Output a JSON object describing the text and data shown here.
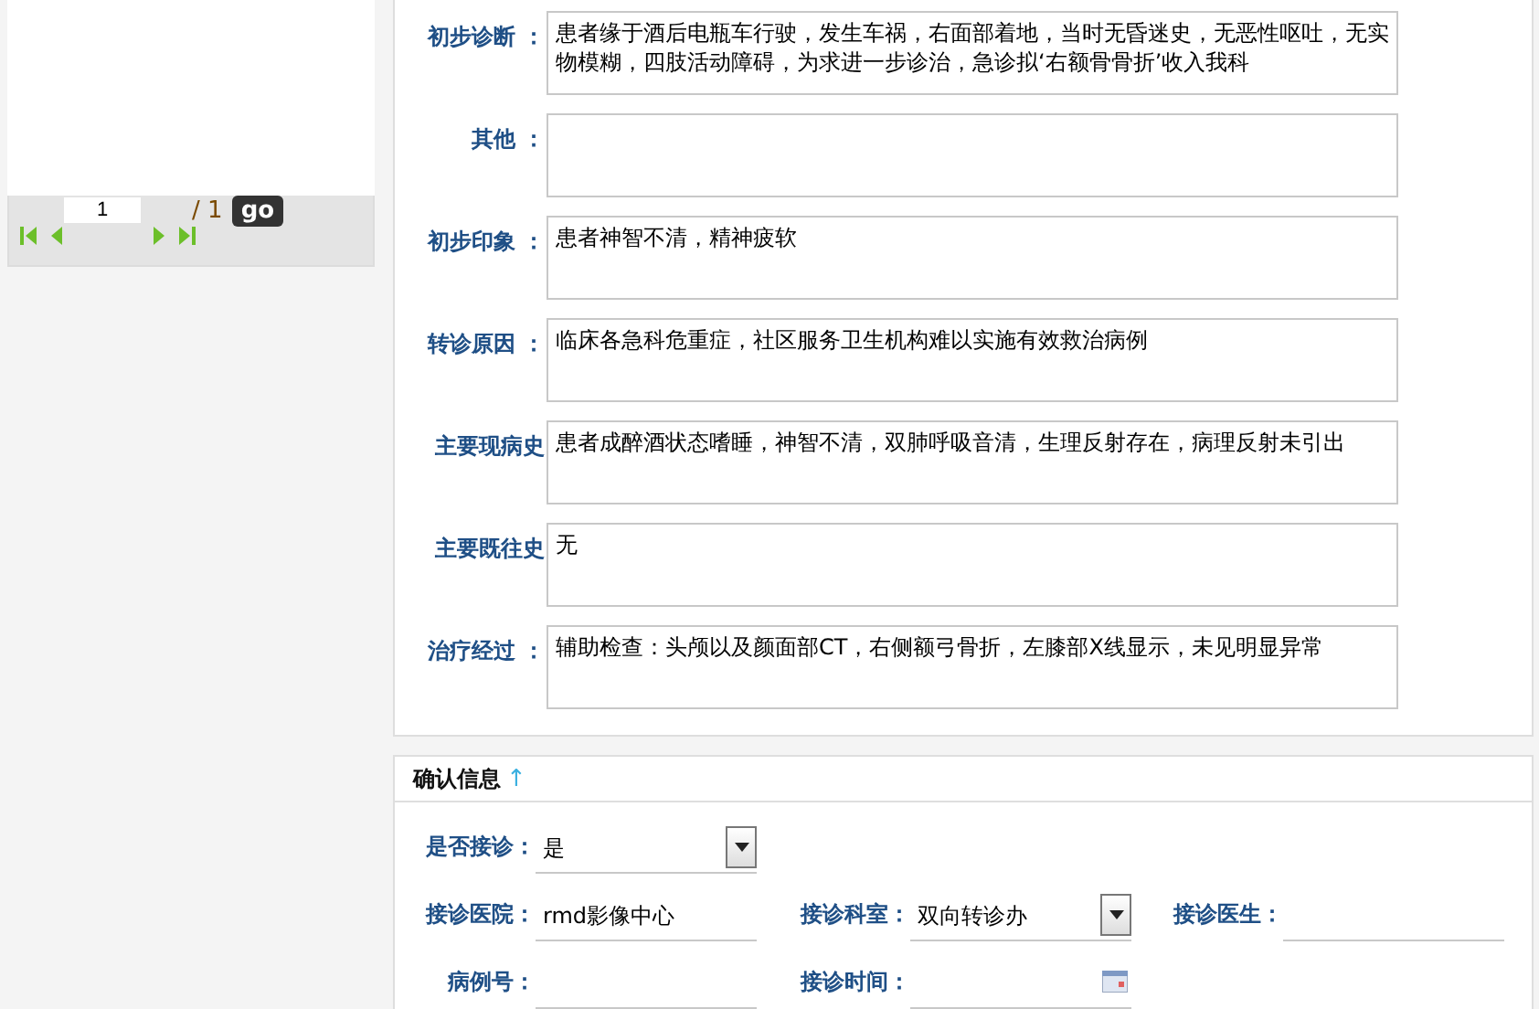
{
  "pager": {
    "page": "1",
    "total": "/ 1",
    "go": "go"
  },
  "record_fields": [
    {
      "label": "初步诊断 ：",
      "value": "患者缘于酒后电瓶车行驶，发生车祸，右面部着地，当时无昏迷史，无恶性呕吐，无实物模糊，四肢活动障碍，为求进一步诊治，急诊拟‘右额骨骨折’收入我科"
    },
    {
      "label": "其他 ："
    },
    {
      "label": "初步印象 ：",
      "value": "患者神智不清，精神疲软"
    },
    {
      "label": "转诊原因 ：",
      "value": "临床各急科危重症，社区服务卫生机构难以实施有效救治病例"
    },
    {
      "label": "主要现病史",
      "value": "患者成醉酒状态嗜睡，神智不清，双肺呼吸音清，生理反射存在，病理反射未引出"
    },
    {
      "label": "主要既往史",
      "value": "无"
    },
    {
      "label": "治疗经过 ：",
      "value": "辅助检查：头颅以及颜面部CT，右侧额弓骨折，左膝部X线显示，未见明显异常"
    }
  ],
  "confirm": {
    "title": "确认信息",
    "arrow": "↑",
    "rows": [
      [
        {
          "label": "是否接诊：",
          "kind": "select",
          "value": "是"
        }
      ],
      [
        {
          "label": "接诊医院：",
          "kind": "text",
          "value": "rmd影像中心"
        },
        {
          "label": "接诊科室：",
          "kind": "select",
          "value": "双向转诊办"
        },
        {
          "label": "接诊医生：",
          "kind": "text"
        }
      ],
      [
        {
          "label": "病例号：",
          "kind": "text"
        },
        {
          "label": "接诊时间：",
          "kind": "date"
        }
      ]
    ]
  }
}
